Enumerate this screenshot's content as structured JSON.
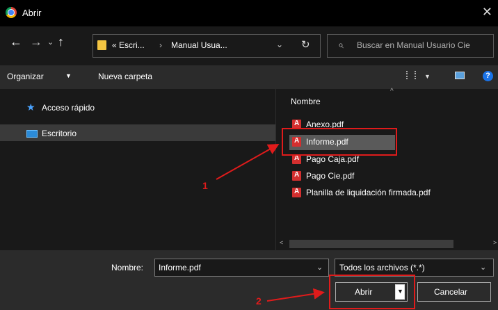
{
  "window": {
    "title": "Abrir",
    "close_glyph": "✕",
    "app_icon": "chrome-icon"
  },
  "nav": {
    "back_glyph": "←",
    "forward_glyph": "→",
    "recent_glyph": "⌄",
    "up_glyph": "↑",
    "breadcrumb": [
      "« Escri...",
      "›",
      "Manual Usua..."
    ],
    "dropdown_glyph": "⌄",
    "refresh_glyph": "↻",
    "search_icon": "⌕",
    "search_placeholder": "Buscar en Manual Usuario Cie"
  },
  "toolbar": {
    "organize_label": "Organizar",
    "organize_caret": "▼",
    "new_folder_label": "Nueva carpeta",
    "view_caret": "▼",
    "help_glyph": "?"
  },
  "sidebar": {
    "items": [
      {
        "label": "Acceso rápido",
        "icon": "★"
      },
      {
        "label": "Escritorio"
      }
    ]
  },
  "content": {
    "column_header": "Nombre",
    "sort_glyph": "^",
    "files": [
      "Anexo.pdf",
      "Informe.pdf",
      "Pago Caja.pdf",
      "Pago Cie.pdf",
      "Planilla de liquidación firmada.pdf"
    ],
    "selected": "Informe.pdf",
    "scroll_left": "<",
    "scroll_right": ">"
  },
  "footer": {
    "filename_label": "Nombre:",
    "filename_value": "Informe.pdf",
    "filetype_value": "Todos los archivos (*.*)",
    "dropdown_glyph": "⌄",
    "open_label": "Abrir",
    "open_split_glyph": "▼",
    "cancel_label": "Cancelar"
  },
  "annotations": {
    "step1": "1",
    "step2": "2",
    "color": "#e01b1b"
  }
}
